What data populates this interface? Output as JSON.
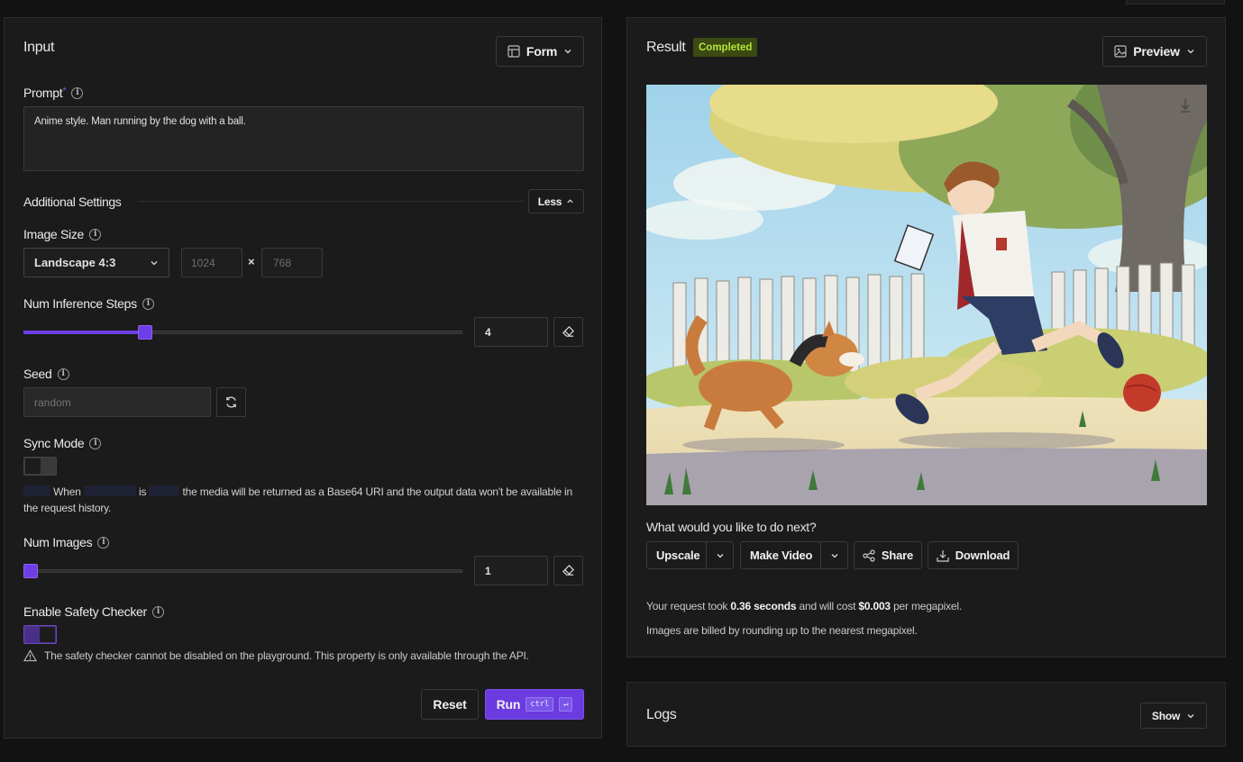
{
  "input_panel": {
    "title": "Input",
    "mode_button": "Form",
    "prompt": {
      "label": "Prompt",
      "required_mark": "*",
      "value": "Anime style. Man running by the dog with a ball."
    },
    "additional_settings": {
      "label": "Additional Settings",
      "toggle_label": "Less"
    },
    "image_size": {
      "label": "Image Size",
      "selected": "Landscape 4:3",
      "width_placeholder": "1024",
      "height_placeholder": "768",
      "separator": "×"
    },
    "num_inference_steps": {
      "label": "Num Inference Steps",
      "value": "4",
      "slider_fraction": 0.27
    },
    "seed": {
      "label": "Seed",
      "placeholder": "random"
    },
    "sync_mode": {
      "label": "Sync Mode",
      "enabled": false,
      "desc_part1": "When",
      "desc_part2": "is",
      "desc_part3": "the media will be returned as a Base64 URI and the output data won't be available in the request history."
    },
    "num_images": {
      "label": "Num Images",
      "value": "1",
      "slider_fraction": 0.0
    },
    "safety_checker": {
      "label": "Enable Safety Checker",
      "enabled": true,
      "warning": "The safety checker cannot be disabled on the playground. This property is only available through the API."
    },
    "reset_button": "Reset",
    "run_button": "Run",
    "run_shortcut_key": "ctrl",
    "run_shortcut_enter": "↵"
  },
  "result_panel": {
    "title": "Result",
    "status_badge": "Completed",
    "view_button": "Preview",
    "next_prompt": "What would you like to do next?",
    "actions": {
      "upscale": "Upscale",
      "make_video": "Make Video",
      "share": "Share",
      "download": "Download"
    },
    "billing": {
      "took_prefix": "Your request took",
      "took_value": "0.36 seconds",
      "cost_prefix": "and will cost",
      "cost_value": "$0.003",
      "cost_suffix": "per megapixel.",
      "note": "Images are billed by rounding up to the nearest megapixel."
    }
  },
  "logs_panel": {
    "title": "Logs",
    "toggle": "Show"
  },
  "colors": {
    "accent": "#6d3ee6",
    "badge_bg": "#3a4a12",
    "badge_text": "#b5e43a"
  }
}
